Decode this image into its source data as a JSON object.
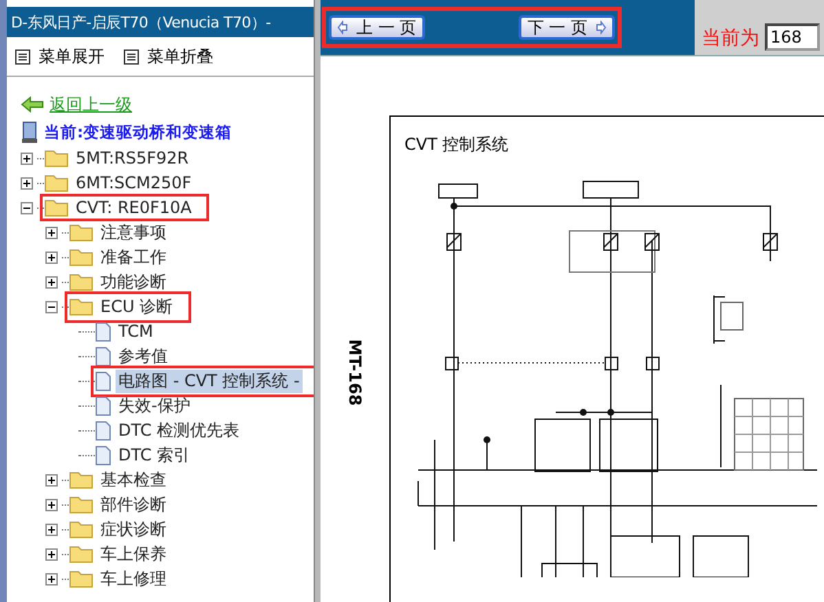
{
  "window": {
    "title": "D-东风日产-启辰T70（Venucia T70）-"
  },
  "menu": [
    {
      "label": "菜单展开"
    },
    {
      "label": "菜单折叠"
    }
  ],
  "back_link": "返回上一级",
  "current": "当前:变速驱动桥和变速箱",
  "tree": [
    {
      "label": "5MT:RS5F92R",
      "kind": "folder",
      "expanded": false,
      "selected": false,
      "annotated": false
    },
    {
      "label": "6MT:SCM250F",
      "kind": "folder",
      "expanded": false,
      "selected": false,
      "annotated": false
    },
    {
      "label": "CVT: RE0F10A",
      "kind": "folder",
      "expanded": true,
      "selected": false,
      "annotated": true,
      "children": [
        {
          "label": "注意事项",
          "kind": "folder",
          "expanded": false,
          "selected": false,
          "annotated": false
        },
        {
          "label": "准备工作",
          "kind": "folder",
          "expanded": false,
          "selected": false,
          "annotated": false
        },
        {
          "label": "功能诊断",
          "kind": "folder",
          "expanded": false,
          "selected": false,
          "annotated": false
        },
        {
          "label": "ECU 诊断",
          "kind": "folder",
          "expanded": true,
          "selected": false,
          "annotated": true,
          "children": [
            {
              "label": "TCM",
              "kind": "page",
              "selected": false,
              "annotated": false
            },
            {
              "label": "参考值",
              "kind": "page",
              "selected": false,
              "annotated": false
            },
            {
              "label": "电路图 - CVT 控制系统 -",
              "kind": "page",
              "selected": true,
              "annotated": true
            },
            {
              "label": "失效-保护",
              "kind": "page",
              "selected": false,
              "annotated": false
            },
            {
              "label": "DTC 检测优先表",
              "kind": "page",
              "selected": false,
              "annotated": false
            },
            {
              "label": "DTC 索引",
              "kind": "page",
              "selected": false,
              "annotated": false
            }
          ]
        },
        {
          "label": "基本检查",
          "kind": "folder",
          "expanded": false,
          "selected": false,
          "annotated": false
        },
        {
          "label": "部件诊断",
          "kind": "folder",
          "expanded": false,
          "selected": false,
          "annotated": false
        },
        {
          "label": "症状诊断",
          "kind": "folder",
          "expanded": false,
          "selected": false,
          "annotated": false
        },
        {
          "label": "车上保养",
          "kind": "folder",
          "expanded": false,
          "selected": false,
          "annotated": false
        },
        {
          "label": "车上修理",
          "kind": "folder",
          "expanded": false,
          "selected": false,
          "annotated": false
        }
      ]
    }
  ],
  "pager": {
    "annotated": true,
    "buttons": [
      {
        "label": "上 一 页",
        "kind": "prev"
      },
      {
        "label": "下 一 页",
        "kind": "next"
      }
    ]
  },
  "page_field": {
    "label": "当前为",
    "value": "168"
  },
  "document": {
    "page_label": "MT-168",
    "title": "CVT 控制系统"
  }
}
